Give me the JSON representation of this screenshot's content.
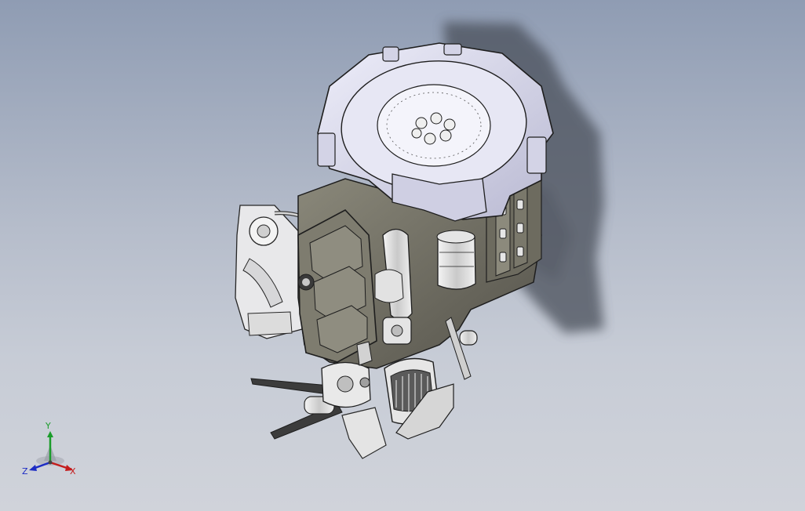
{
  "viewport": {
    "background_top": "#8f9cb3",
    "background_bottom": "#d0d3da",
    "model_subject": "engine-assembly"
  },
  "triad": {
    "x_label": "X",
    "y_label": "Y",
    "z_label": "Z",
    "x_color": "#c41c1c",
    "y_color": "#1a9c2a",
    "z_color": "#1c2bc4"
  },
  "colors": {
    "flywheel_housing": "#dcdcef",
    "engine_block": "#6c6a5e",
    "valve_cover": "#7e7c6f",
    "edge_lines": "#1e1e1e",
    "shadow": "#4a4f5a",
    "fan_blade": "#3c3c3c"
  }
}
